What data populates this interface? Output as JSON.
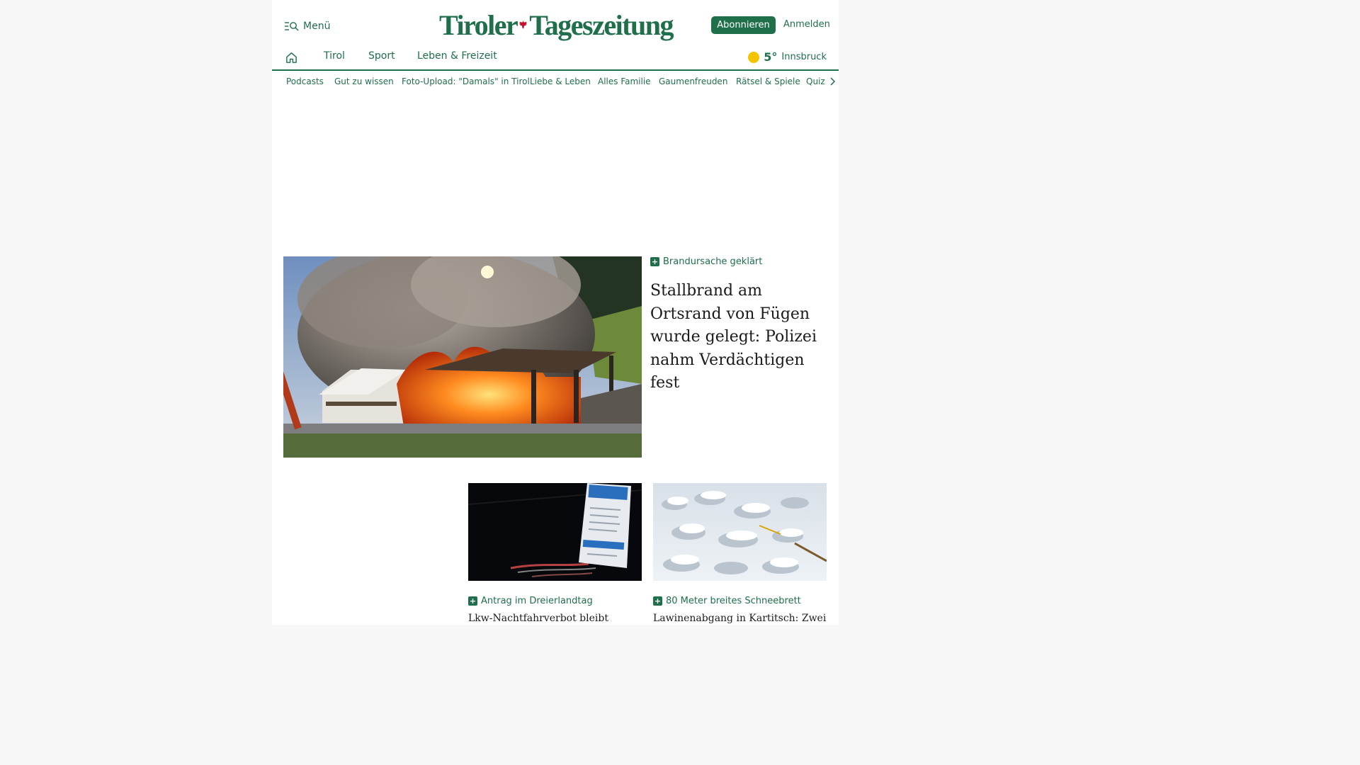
{
  "header": {
    "menu_label": "Menü",
    "logo_part1": "Tiroler",
    "logo_part2": "Tageszeitung",
    "subscribe_label": "Abonnieren",
    "login_label": "Anmelden"
  },
  "nav": {
    "items": [
      "Tirol",
      "Sport",
      "Leben & Freizeit"
    ],
    "weather": {
      "temp": "5°",
      "city": "Innsbruck",
      "icon": "sun-icon",
      "icon_color": "#f5c400"
    }
  },
  "subnav": {
    "items": [
      "Podcasts",
      "Gut zu wissen",
      "Foto-Upload: \"Damals\" in Tirol",
      "Liebe & Leben",
      "Alles Familie",
      "Gaumenfreuden",
      "Rätsel & Spiele",
      "Quiz"
    ]
  },
  "hero": {
    "kicker": "Brandursache geklärt",
    "title": "Stallbrand am Ortsrand von Fügen wurde gelegt: Polizei nahm Verdächtigen fest"
  },
  "cards": [
    {
      "kicker": "Antrag im Dreierlandtag",
      "title": "Lkw-Nachtfahrverbot bleibt"
    },
    {
      "kicker": "80 Meter breites Schneebrett",
      "title": "Lawinenabgang in Kartitsch: Zwei"
    }
  ],
  "colors": {
    "brand": "#1f6f4a",
    "logo_eagle": "#c8102e"
  }
}
